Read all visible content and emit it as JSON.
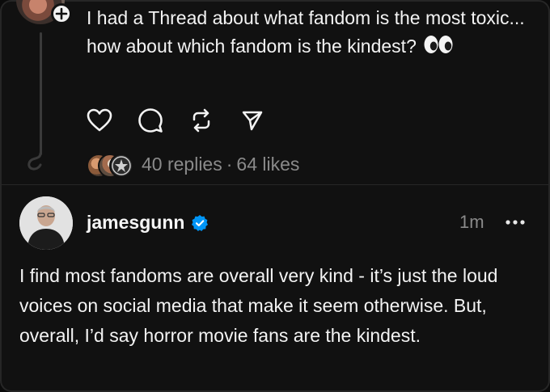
{
  "post1": {
    "text": "I had a Thread about what fandom is the most toxic... how about which fandom is the kindest?",
    "emoji": "eyes-emoji",
    "follow_icon": "plus-icon",
    "actions": [
      {
        "name": "like",
        "icon": "heart-icon"
      },
      {
        "name": "reply",
        "icon": "comment-icon"
      },
      {
        "name": "repost",
        "icon": "repost-icon"
      },
      {
        "name": "share",
        "icon": "send-icon"
      }
    ],
    "replies": "40 replies",
    "separator": "·",
    "likes": "64 likes"
  },
  "post2": {
    "username": "jamesgunn",
    "verified_icon": "verified-badge-icon",
    "verified_color": "#0095f6",
    "time": "1m",
    "more_icon": "more-options-icon",
    "text": "I find most fandoms are overall very kind - it’s just the loud voices on social media that make it seem otherwise. But, overall, I’d say horror movie fans are the kindest."
  }
}
